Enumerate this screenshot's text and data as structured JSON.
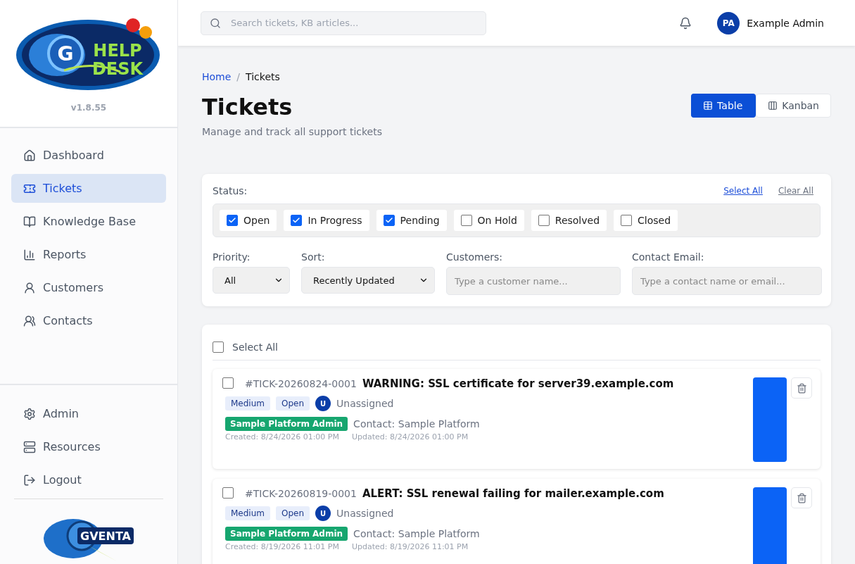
{
  "sidebar": {
    "logo": {
      "letter": "G",
      "line1": "HELP",
      "line2": "DESK"
    },
    "version": "v1.8.55",
    "items": [
      {
        "label": "Dashboard",
        "selected": false
      },
      {
        "label": "Tickets",
        "selected": true
      },
      {
        "label": "Knowledge Base",
        "selected": false
      },
      {
        "label": "Reports",
        "selected": false
      },
      {
        "label": "Customers",
        "selected": false
      },
      {
        "label": "Contacts",
        "selected": false
      }
    ],
    "bottom_items": [
      {
        "label": "Admin",
        "selected": false
      },
      {
        "label": "Resources",
        "selected": false
      },
      {
        "label": "Logout",
        "selected": false
      }
    ],
    "footer_logo": {
      "text": "GVENTA"
    }
  },
  "header": {
    "search": {
      "placeholder": "Search tickets, KB articles..."
    },
    "user": {
      "initials": "PA",
      "name": "Example Admin"
    }
  },
  "breadcrumb": [
    {
      "label": "Home",
      "kind": "link"
    },
    {
      "label": "/",
      "kind": "separator"
    },
    {
      "label": "Tickets",
      "kind": "current"
    }
  ],
  "page": {
    "title": "Tickets",
    "subtitle": "Manage and track all support tickets"
  },
  "view_toggle": [
    {
      "label": "Table",
      "selected": true
    },
    {
      "label": "Kanban",
      "selected": false
    }
  ],
  "filters": {
    "status_label": "Status:",
    "select_all": "Select All",
    "clear_all": "Clear All",
    "statuses": [
      {
        "label": "Open",
        "checked": true
      },
      {
        "label": "In Progress",
        "checked": true
      },
      {
        "label": "Pending",
        "checked": true
      },
      {
        "label": "On Hold",
        "checked": false
      },
      {
        "label": "Resolved",
        "checked": false
      },
      {
        "label": "Closed",
        "checked": false
      }
    ],
    "priority": {
      "label": "Priority:",
      "value": "All"
    },
    "sort": {
      "label": "Sort:",
      "value": "Recently Updated"
    },
    "customers": {
      "label": "Customers:",
      "placeholder": "Type a customer name..."
    },
    "contact_email": {
      "label": "Contact Email:",
      "placeholder": "Type a contact name or email..."
    }
  },
  "list": {
    "select_all": {
      "label": "Select All",
      "checked": false
    },
    "tickets": [
      {
        "checked": false,
        "id": "#TICK-20260824-0001",
        "title": "WARNING: SSL certificate for server39.example.com",
        "priority": "Medium",
        "status": "Open",
        "assignee_initial": "U",
        "assignee": "Unassigned",
        "customer": "Sample Platform Admin",
        "contact": "Contact: Sample Platform",
        "created": "Created: 8/24/2026 01:00 PM",
        "updated": "Updated: 8/24/2026 01:00 PM",
        "color": "#0b63f6"
      },
      {
        "checked": false,
        "id": "#TICK-20260819-0001",
        "title": "ALERT: SSL renewal failing for mailer.example.com",
        "priority": "Medium",
        "status": "Open",
        "assignee_initial": "U",
        "assignee": "Unassigned",
        "customer": "Sample Platform Admin",
        "contact": "Contact: Sample Platform",
        "created": "Created: 8/19/2026 11:01 PM",
        "updated": "Updated: 8/19/2026 11:01 PM",
        "color": "#0b63f6"
      }
    ]
  }
}
